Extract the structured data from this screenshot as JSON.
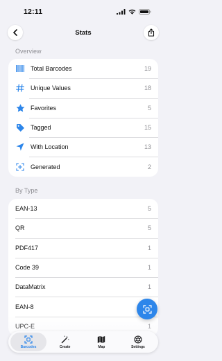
{
  "status_bar": {
    "time": "12:11"
  },
  "nav": {
    "title": "Stats"
  },
  "overview": {
    "header": "Overview",
    "items": [
      {
        "label": "Total Barcodes",
        "value": "19",
        "icon": "barcode-icon"
      },
      {
        "label": "Unique Values",
        "value": "18",
        "icon": "hash-icon"
      },
      {
        "label": "Favorites",
        "value": "5",
        "icon": "star-icon"
      },
      {
        "label": "Tagged",
        "value": "15",
        "icon": "tag-icon"
      },
      {
        "label": "With Location",
        "value": "13",
        "icon": "location-arrow-icon"
      },
      {
        "label": "Generated",
        "value": "2",
        "icon": "scan-frame-icon"
      }
    ]
  },
  "by_type": {
    "header": "By Type",
    "items": [
      {
        "label": "EAN-13",
        "value": "5"
      },
      {
        "label": "QR",
        "value": "5"
      },
      {
        "label": "PDF417",
        "value": "1"
      },
      {
        "label": "Code 39",
        "value": "1"
      },
      {
        "label": "DataMatrix",
        "value": "1"
      },
      {
        "label": "EAN-8",
        "value": "1"
      },
      {
        "label": "UPC-E",
        "value": "1"
      }
    ]
  },
  "tab_bar": {
    "tabs": [
      {
        "label": "Barcodes",
        "icon": "scan-frame-icon",
        "active": true
      },
      {
        "label": "Create",
        "icon": "magic-wand-icon",
        "active": false
      },
      {
        "label": "Map",
        "icon": "map-icon",
        "active": false
      },
      {
        "label": "Settings",
        "icon": "gear-icon",
        "active": false
      }
    ]
  },
  "colors": {
    "accent": "#2d86ea",
    "background": "#f2f2f7",
    "secondary_text": "#8e8e93"
  }
}
